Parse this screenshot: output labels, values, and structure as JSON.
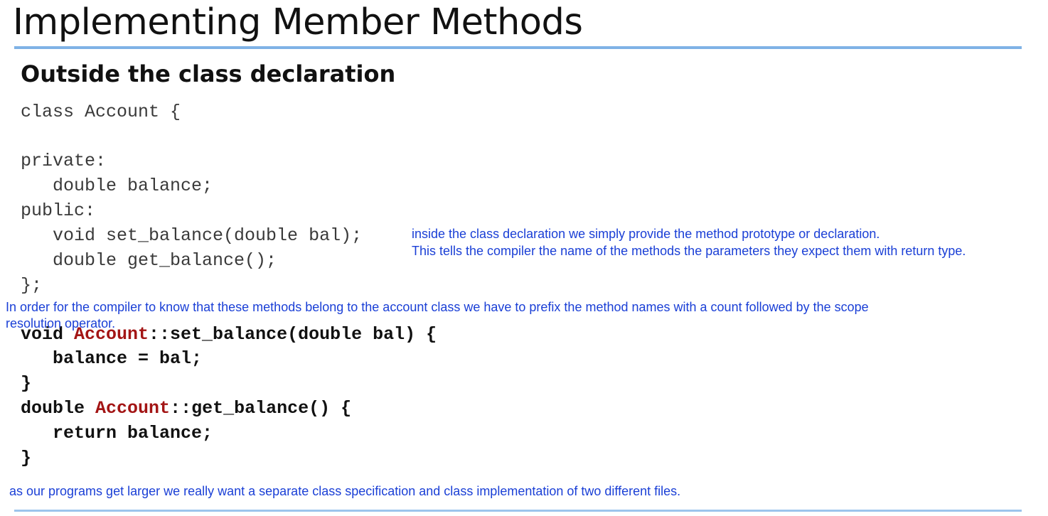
{
  "title": "Implementing Member Methods",
  "subtitle": "Outside the class declaration",
  "declaration": {
    "line1": "class Account {",
    "line2": "private:",
    "line3": "   double balance;",
    "line4": "public:",
    "line5": "   void set_balance(double bal);",
    "line6": "   double get_balance();",
    "line7": "};"
  },
  "implementation": {
    "line1_prefix": "void ",
    "class_name": "Account",
    "line1_suffix": "::set_balance(double bal) {",
    "line2": "   balance = bal;",
    "line3": "}",
    "line4_prefix": "double ",
    "line4_suffix": "::get_balance() {",
    "line5": "   return balance;",
    "line6": "}"
  },
  "annotations": {
    "prototype_line1": "inside the class declaration we simply provide the method prototype or declaration.",
    "prototype_line2": "This tells the compiler the name of the methods the parameters they expect them with return type.",
    "scope_line1": "In order for the compiler to know that these methods belong to the account class we have to prefix the method names with a count followed by the scope",
    "scope_line2": "resolution operator.",
    "separate_files": "as our programs get larger we really want a separate class specification and class implementation of two different files."
  },
  "colors": {
    "accent_rule": "#7fb2e6",
    "annotation": "#1a3fd6",
    "class_name": "#a31515"
  }
}
